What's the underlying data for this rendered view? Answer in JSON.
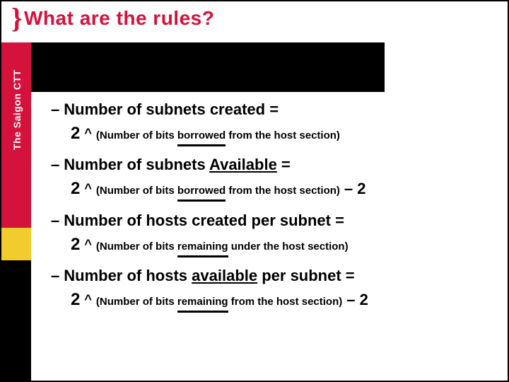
{
  "brace": "}",
  "title": "What are the rules?",
  "sidebar_label": "The Saigon CTT",
  "rules": [
    {
      "head_pre": "Number of subnets created =",
      "base": "2",
      "caret": "^",
      "exp_pre": "(Number of bits ",
      "exp_uword": "borrowed",
      "exp_post": " from the host section)",
      "suffix": ""
    },
    {
      "head_pre": "Number of subnets ",
      "head_uword": "Available",
      "head_post": " =",
      "base": "2",
      "caret": "^",
      "exp_pre": "(Number of bits ",
      "exp_uword": "borrowed",
      "exp_post": " from the host section)",
      "suffix": "– 2"
    },
    {
      "head_pre": "Number of  hosts created per subnet =",
      "base": "2",
      "caret": "^",
      "exp_pre": "(Number of bits ",
      "exp_uword": "remaining",
      "exp_post": " under  the host section)",
      "suffix": ""
    },
    {
      "head_pre": "Number of hosts ",
      "head_uword": "available",
      "head_post": " per subnet =",
      "base": "2",
      "caret": "^",
      "exp_pre": "(Number of bits ",
      "exp_uword": "remaining",
      "exp_post": " from the host section)",
      "suffix": "– 2"
    }
  ]
}
